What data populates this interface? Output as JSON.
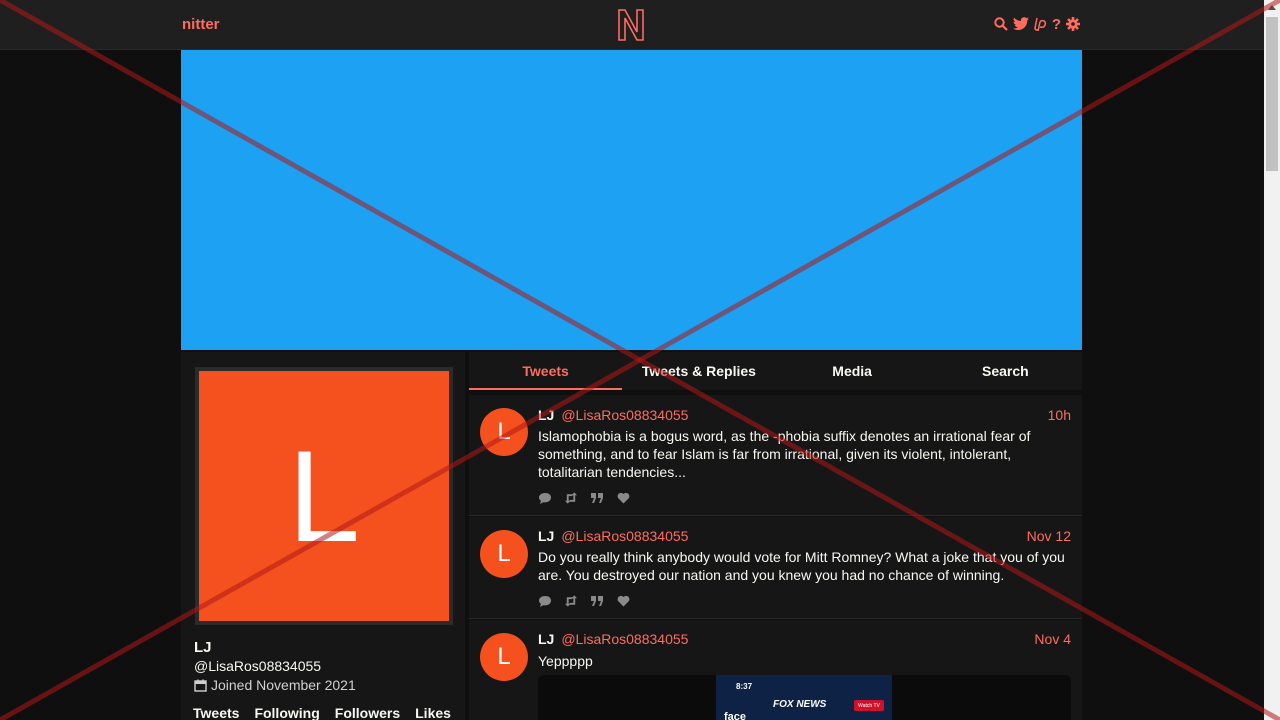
{
  "nav": {
    "brand": "nitter",
    "logo_letter": "N",
    "icons": [
      "search-icon",
      "twitter-bird-icon",
      "liberapay-icon",
      "help-icon",
      "settings-gear-icon"
    ],
    "help_glyph": "?"
  },
  "colors": {
    "accent": "#ff6c60",
    "banner": "#1da1f2",
    "avatar": "#f4511e",
    "background": "#0f0f0f",
    "panel": "#161616"
  },
  "profile": {
    "avatar_letter": "L",
    "fullname": "LJ",
    "username": "@LisaRos08834055",
    "joined": "Joined November 2021",
    "stats": [
      "Tweets",
      "Following",
      "Followers",
      "Likes"
    ]
  },
  "tabs": [
    {
      "label": "Tweets",
      "active": true
    },
    {
      "label": "Tweets & Replies",
      "active": false
    },
    {
      "label": "Media",
      "active": false
    },
    {
      "label": "Search",
      "active": false
    }
  ],
  "tweets": [
    {
      "avatar_letter": "L",
      "fullname": "LJ",
      "username": "@LisaRos08834055",
      "date": "10h",
      "text": "Islamophobia is a bogus word, as the -phobia suffix denotes an irrational fear of something, and to fear Islam is far from irrational, given its violent, intolerant, totalitarian tendencies..."
    },
    {
      "avatar_letter": "L",
      "fullname": "LJ",
      "username": "@LisaRos08834055",
      "date": "Nov 12",
      "text": "Do you really think anybody would vote for Mitt Romney? What a joke that you of you are. You destroyed our nation and you knew you had no chance of winning."
    },
    {
      "avatar_letter": "L",
      "fullname": "LJ",
      "username": "@LisaRos08834055",
      "date": "Nov 4",
      "text": "Yeppppp",
      "media": {
        "time": "8:37",
        "channel": "FOX NEWS",
        "watch": "Watch TV",
        "caption": "face"
      }
    }
  ],
  "tweet_actions": [
    "comment-icon",
    "retweet-icon",
    "quote-icon",
    "heart-icon"
  ]
}
